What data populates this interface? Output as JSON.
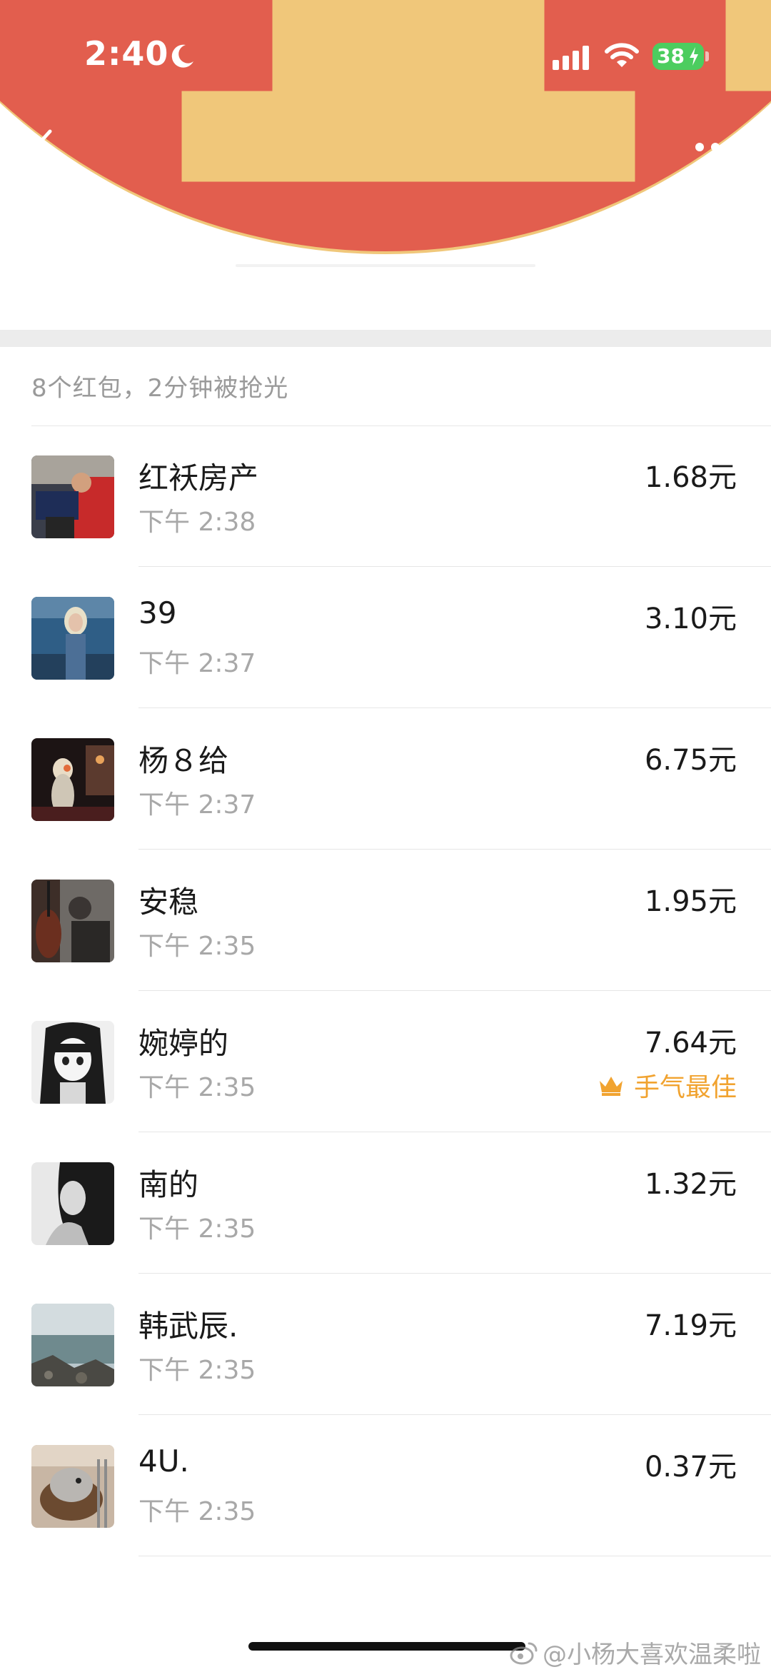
{
  "status_bar": {
    "time": "2:40",
    "battery": "38"
  },
  "summary": "8个红包，2分钟被抢光",
  "entries": [
    {
      "name": "红袄房产",
      "time": "下午 2:38",
      "amount": "1.68元"
    },
    {
      "name": "39",
      "time": "下午 2:37",
      "amount": "3.10元"
    },
    {
      "name": "杨８给",
      "time": "下午 2:37",
      "amount": "6.75元"
    },
    {
      "name": "安稳",
      "time": "下午 2:35",
      "amount": "1.95元"
    },
    {
      "name": "婉婷的",
      "time": "下午 2:35",
      "amount": "7.64元",
      "badge": "手气最佳"
    },
    {
      "name": "南的",
      "time": "下午 2:35",
      "amount": "1.32元"
    },
    {
      "name": "韩武辰.",
      "time": "下午 2:35",
      "amount": "7.19元"
    },
    {
      "name": "4U.",
      "time": "下午 2:35",
      "amount": "0.37元"
    }
  ],
  "watermark": "@小杨大喜欢温柔啦",
  "colors": {
    "header_red": "#e25e4e",
    "gold_trim": "#f0c77a",
    "best_luck": "#f1a330",
    "battery_green": "#4ccd5f"
  },
  "icons": [
    "moon-icon",
    "signal-icon",
    "wifi-icon",
    "battery-bolt-icon",
    "back-arrow-icon",
    "more-dots-icon",
    "crown-icon",
    "weibo-icon"
  ]
}
